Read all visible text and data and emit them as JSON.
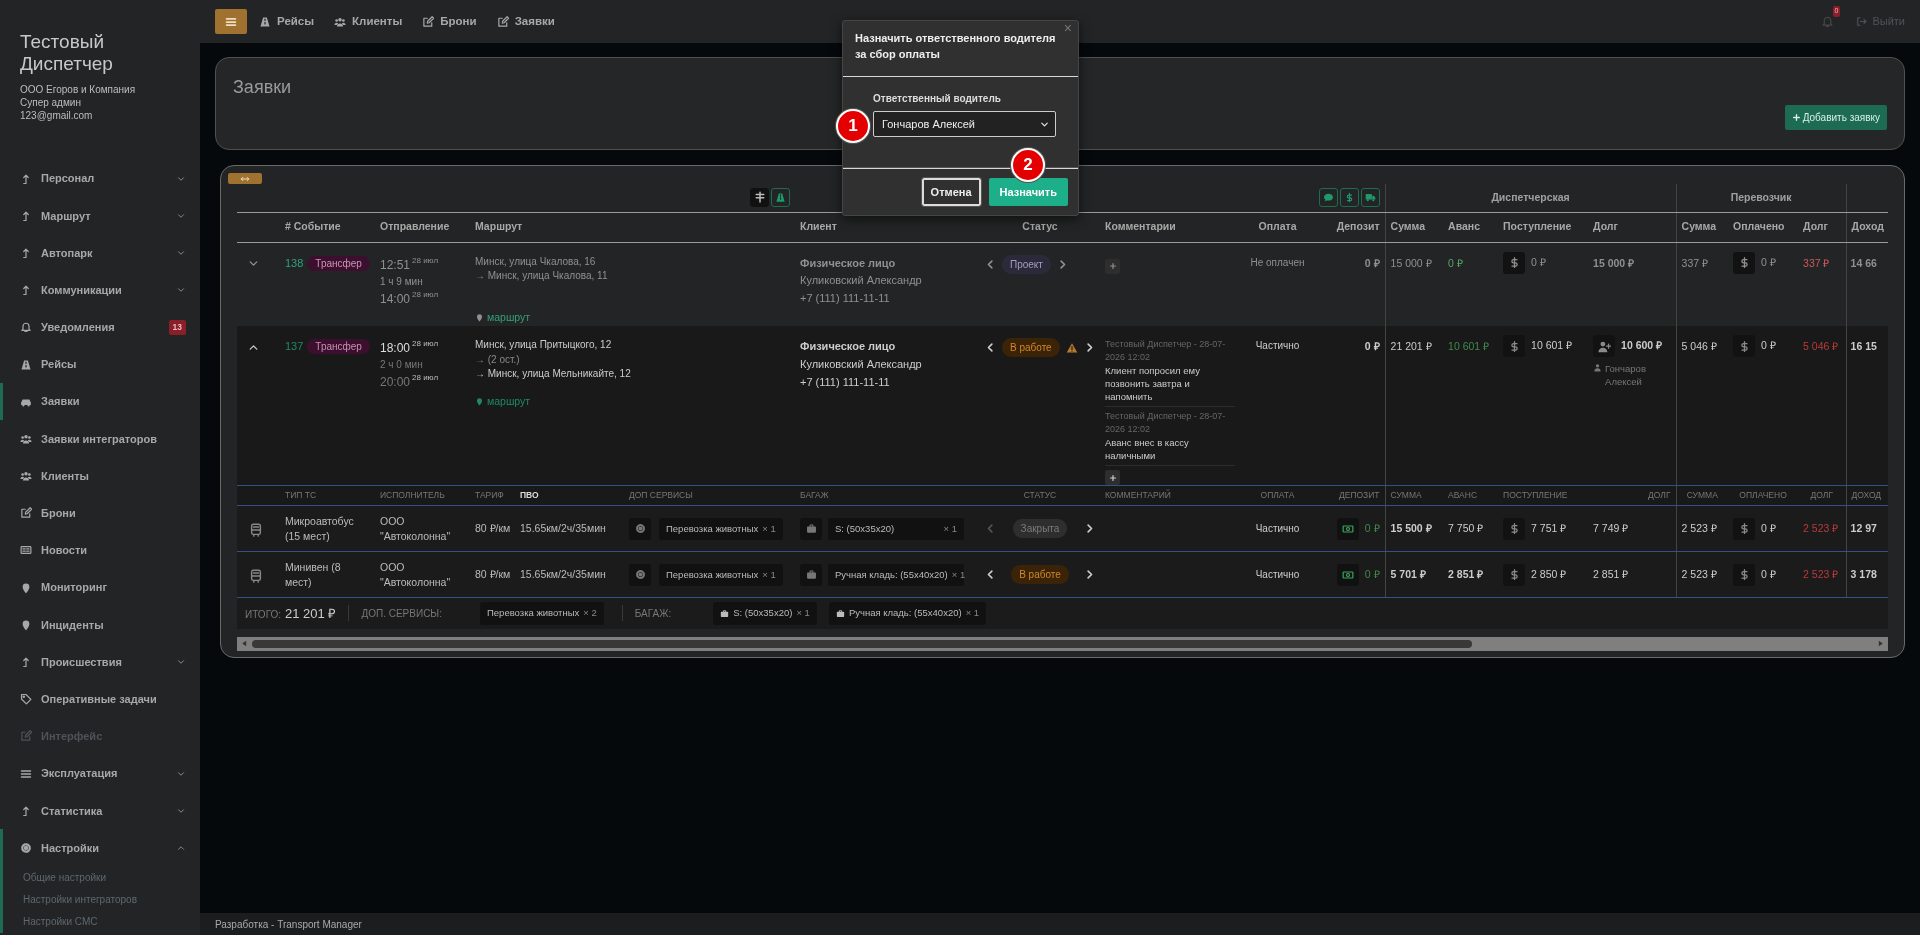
{
  "sidebar": {
    "title": "Тестовый Диспетчер",
    "company": "ООО Егоров и Компания",
    "role": "Супер админ",
    "email": "123@gmail.com",
    "items": [
      {
        "label": "Персонал",
        "kind": "group",
        "expanded": false,
        "selected": false,
        "disabled": false
      },
      {
        "label": "Маршрут",
        "kind": "group",
        "expanded": false,
        "selected": false,
        "disabled": false
      },
      {
        "label": "Автопарк",
        "kind": "group",
        "expanded": false,
        "selected": false,
        "disabled": false
      },
      {
        "label": "Коммуникации",
        "kind": "group",
        "expanded": false,
        "selected": false,
        "disabled": false
      },
      {
        "label": "Уведомления",
        "kind": "link",
        "badge": "13",
        "selected": false,
        "disabled": false
      },
      {
        "label": "Рейсы",
        "kind": "link",
        "selected": false,
        "disabled": false
      },
      {
        "label": "Заявки",
        "kind": "link",
        "selected": true,
        "disabled": false
      },
      {
        "label": "Заявки интеграторов",
        "kind": "link",
        "selected": false,
        "disabled": false
      },
      {
        "label": "Клиенты",
        "kind": "link",
        "selected": false,
        "disabled": false
      },
      {
        "label": "Брони",
        "kind": "link",
        "selected": false,
        "disabled": false
      },
      {
        "label": "Новости",
        "kind": "link",
        "selected": false,
        "disabled": false
      },
      {
        "label": "Мониторинг",
        "kind": "link",
        "selected": false,
        "disabled": false
      },
      {
        "label": "Инциденты",
        "kind": "link",
        "selected": false,
        "disabled": false
      },
      {
        "label": "Происшествия",
        "kind": "group",
        "expanded": false,
        "selected": false,
        "disabled": false
      },
      {
        "label": "Оперативные задачи",
        "kind": "link",
        "selected": false,
        "disabled": false
      },
      {
        "label": "Интерфейс",
        "kind": "link",
        "selected": false,
        "disabled": true
      },
      {
        "label": "Эксплуатация",
        "kind": "group",
        "expanded": false,
        "selected": false,
        "disabled": false
      },
      {
        "label": "Статистика",
        "kind": "group",
        "expanded": false,
        "selected": false,
        "disabled": false
      },
      {
        "label": "Настройки",
        "kind": "group",
        "expanded": true,
        "selected": true,
        "disabled": false,
        "children": [
          {
            "label": "Общие настройки"
          },
          {
            "label": "Настройки интеграторов"
          },
          {
            "label": "Настройки СМС"
          }
        ]
      }
    ]
  },
  "topbar": {
    "nav": [
      {
        "label": "Рейсы"
      },
      {
        "label": "Клиенты"
      },
      {
        "label": "Брони"
      },
      {
        "label": "Заявки"
      }
    ],
    "notifications": "0",
    "logout": "Выйти"
  },
  "page": {
    "title": "Заявки",
    "add_button": "Добавить заявку"
  },
  "table": {
    "groups": [
      "Диспетчерская",
      "Перевозчик"
    ],
    "columns": [
      "# Событие",
      "Отправление",
      "Маршрут",
      "Клиент",
      "Статус",
      "Комментарии",
      "Оплата",
      "Депозит",
      "Сумма",
      "Аванс",
      "Поступление",
      "Долг",
      "Сумма",
      "Оплачено",
      "Долг",
      "Доход"
    ],
    "rows": [
      {
        "expanded": false,
        "number": "138",
        "event_type": "Трансфер",
        "departure": {
          "time": "12:51",
          "date": "28 июл"
        },
        "duration": "1 ч 9 мин",
        "arrival": {
          "time": "14:00",
          "date": "28 июл"
        },
        "route": [
          "Минск, улица Чкалова, 16",
          "→ Минск, улица Чкалова, 11"
        ],
        "route_link": "маршрут",
        "client": {
          "type": "Физическое лицо",
          "name": "Куликовский Александр",
          "phone": "+7 (111) 111-11-11"
        },
        "status": {
          "label": "Проект",
          "kind": "draft"
        },
        "can_go_back": false,
        "warning": false,
        "comments": [],
        "payment": "Не оплачен",
        "deposit": "0 ₽",
        "dispatch": {
          "sum": "15 000 ₽",
          "advance": "0 ₽",
          "income": "0 ₽",
          "debt": "15 000 ₽"
        },
        "carrier": {
          "sum": "337 ₽",
          "paid": "0 ₽",
          "debt": "337 ₽"
        },
        "profit": "14 66"
      },
      {
        "expanded": true,
        "number": "137",
        "event_type": "Трансфер",
        "departure": {
          "time": "18:00",
          "date": "28 июл"
        },
        "duration": "2 ч 0 мин",
        "arrival": {
          "time": "20:00",
          "date": "28 июл"
        },
        "route": [
          "Минск, улица Притыцкого, 12",
          "→ (2 ост.)",
          "→ Минск, улица Мельникайте, 12"
        ],
        "route_link": "маршрут",
        "client": {
          "type": "Физическое лицо",
          "name": "Куликовский Александр",
          "phone": "+7 (111) 111-11-11"
        },
        "status": {
          "label": "В работе",
          "kind": "in_progress"
        },
        "can_go_back": true,
        "warning": true,
        "comments": [
          {
            "meta": "Тестовый Диспетчер - 28-07-2026 12:02",
            "text": "Клиент попросил ему позвонить завтра и напомнить"
          },
          {
            "meta": "Тестовый Диспетчер - 28-07-2026 12:02",
            "text": "Аванс внес в кассу наличными"
          }
        ],
        "payment": "Частично",
        "deposit": "0 ₽",
        "dispatch": {
          "sum": "21 201 ₽",
          "advance": "10 601 ₽",
          "income": "10 601 ₽",
          "debt": "10 600 ₽",
          "driver": "Гончаров Алексей"
        },
        "carrier": {
          "sum": "5 046 ₽",
          "paid": "0 ₽",
          "debt": "5 046 ₽"
        },
        "profit": "16 15",
        "vehicle_columns": [
          "ТИП ТС",
          "ИСПОЛНИТЕЛЬ",
          "ТАРИФ",
          "ПВО",
          "ДОП СЕРВИСЫ",
          "БАГАЖ",
          "СТАТУС",
          "КОММЕНТАРИЙ",
          "ОПЛАТА",
          "ДЕПОЗИТ",
          "СУММА",
          "АВАНС",
          "ПОСТУПЛЕНИЕ",
          "ДОЛГ",
          "СУММА",
          "ОПЛАЧЕНО",
          "ДОЛГ",
          "ДОХОД"
        ],
        "vehicles": [
          {
            "type": "Микроавтобус (15 мест)",
            "contractor": "ООО \"Автоколонна\"",
            "tariff": "80 ₽/км",
            "pvo": "15.65км/2ч/35мин",
            "service": {
              "label": "Перевозка животных",
              "count": "× 1"
            },
            "baggage": {
              "label": "S: (50x35x20)",
              "count": "× 1"
            },
            "status": {
              "label": "Закрыта",
              "kind": "closed"
            },
            "can_go_back": false,
            "payment": "Частично",
            "deposit": "0 ₽",
            "sum": "15 500 ₽",
            "advance": "7 750 ₽",
            "advance_emphasis": false,
            "income": "7 751 ₽",
            "debt": "7 749 ₽",
            "carrier": {
              "sum": "2 523 ₽",
              "paid": "0 ₽",
              "debt": "2 523 ₽"
            },
            "profit": "12 97"
          },
          {
            "type": "Минивен (8 мест)",
            "contractor": "ООО \"Автоколонна\"",
            "tariff": "80 ₽/км",
            "pvo": "15.65км/2ч/35мин",
            "service": {
              "label": "Перевозка животных",
              "count": "× 1"
            },
            "baggage": {
              "label": "Ручная кладь: (55x40x20)",
              "count": "× 1"
            },
            "status": {
              "label": "В работе",
              "kind": "in_progress"
            },
            "can_go_back": true,
            "payment": "Частично",
            "deposit": "0 ₽",
            "sum": "5 701 ₽",
            "advance": "2 851 ₽",
            "advance_emphasis": true,
            "income": "2 850 ₽",
            "debt": "2 851 ₽",
            "carrier": {
              "sum": "2 523 ₽",
              "paid": "0 ₽",
              "debt": "2 523 ₽"
            },
            "profit": "3 178"
          }
        ],
        "totals": {
          "label": "ИТОГО:",
          "value": "21 201 ₽",
          "services_label": "ДОП. СЕРВИСЫ:",
          "services": [
            {
              "label": "Перевозка животных",
              "count": "× 2"
            }
          ],
          "baggage_label": "БАГАЖ:",
          "baggage": [
            {
              "label": "S: (50x35x20)",
              "count": "× 1"
            },
            {
              "label": "Ручная кладь: (55x40x20)",
              "count": "× 1"
            }
          ]
        }
      }
    ]
  },
  "modal": {
    "title": "Назначить ответственного водителя за сбор оплаты",
    "close": "×",
    "field_label": "Ответственный водитель",
    "value": "Гончаров Алексей",
    "cancel": "Отмена",
    "confirm": "Назначить"
  },
  "annotations": [
    "1",
    "2"
  ],
  "footer": "Разработка - Transport Manager"
}
